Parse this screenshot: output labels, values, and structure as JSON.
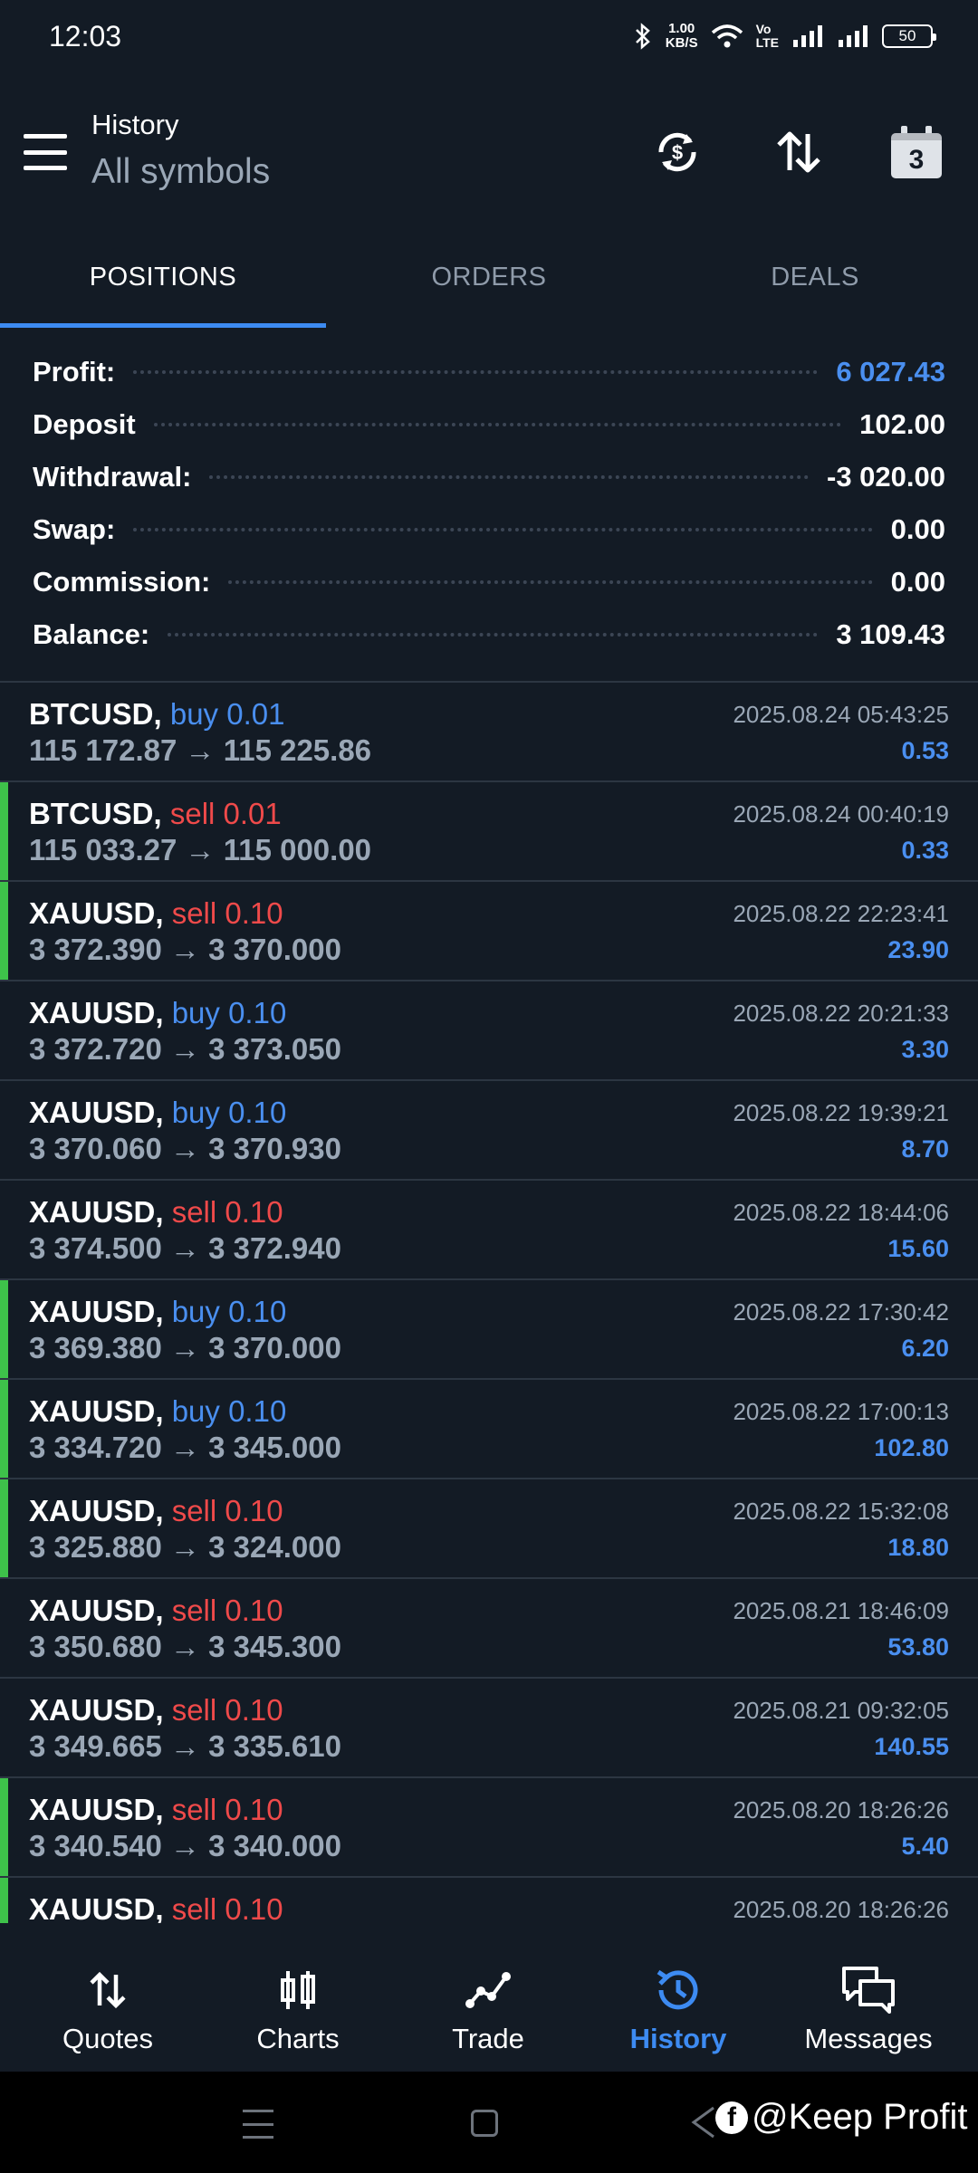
{
  "status_bar": {
    "time": "12:03",
    "speed_top": "1.00",
    "speed_bottom": "KB/S",
    "volte_top": "Vo",
    "volte_bottom": "LTE",
    "battery": "50"
  },
  "header": {
    "title": "History",
    "subtitle": "All symbols",
    "calendar_day": "3"
  },
  "tabs": [
    {
      "label": "POSITIONS",
      "active": true
    },
    {
      "label": "ORDERS",
      "active": false
    },
    {
      "label": "DEALS",
      "active": false
    }
  ],
  "summary": [
    {
      "label": "Profit:",
      "value": "6 027.43",
      "highlight": true
    },
    {
      "label": "Deposit",
      "value": "102.00",
      "highlight": false
    },
    {
      "label": "Withdrawal:",
      "value": "-3 020.00",
      "highlight": false
    },
    {
      "label": "Swap:",
      "value": "0.00",
      "highlight": false
    },
    {
      "label": "Commission:",
      "value": "0.00",
      "highlight": false
    },
    {
      "label": "Balance:",
      "value": "3 109.43",
      "highlight": false
    }
  ],
  "positions": [
    {
      "symbol": "BTCUSD,",
      "side": "buy 0.01",
      "type": "buy",
      "open": "115 172.87",
      "close": "115 225.86",
      "time": "2025.08.24 05:43:25",
      "profit": "0.53",
      "marked": false
    },
    {
      "symbol": "BTCUSD,",
      "side": "sell 0.01",
      "type": "sell",
      "open": "115 033.27",
      "close": "115 000.00",
      "time": "2025.08.24 00:40:19",
      "profit": "0.33",
      "marked": true
    },
    {
      "symbol": "XAUUSD,",
      "side": "sell 0.10",
      "type": "sell",
      "open": "3 372.390",
      "close": "3 370.000",
      "time": "2025.08.22 22:23:41",
      "profit": "23.90",
      "marked": true
    },
    {
      "symbol": "XAUUSD,",
      "side": "buy 0.10",
      "type": "buy",
      "open": "3 372.720",
      "close": "3 373.050",
      "time": "2025.08.22 20:21:33",
      "profit": "3.30",
      "marked": false
    },
    {
      "symbol": "XAUUSD,",
      "side": "buy 0.10",
      "type": "buy",
      "open": "3 370.060",
      "close": "3 370.930",
      "time": "2025.08.22 19:39:21",
      "profit": "8.70",
      "marked": false
    },
    {
      "symbol": "XAUUSD,",
      "side": "sell 0.10",
      "type": "sell",
      "open": "3 374.500",
      "close": "3 372.940",
      "time": "2025.08.22 18:44:06",
      "profit": "15.60",
      "marked": false
    },
    {
      "symbol": "XAUUSD,",
      "side": "buy 0.10",
      "type": "buy",
      "open": "3 369.380",
      "close": "3 370.000",
      "time": "2025.08.22 17:30:42",
      "profit": "6.20",
      "marked": true
    },
    {
      "symbol": "XAUUSD,",
      "side": "buy 0.10",
      "type": "buy",
      "open": "3 334.720",
      "close": "3 345.000",
      "time": "2025.08.22 17:00:13",
      "profit": "102.80",
      "marked": true
    },
    {
      "symbol": "XAUUSD,",
      "side": "sell 0.10",
      "type": "sell",
      "open": "3 325.880",
      "close": "3 324.000",
      "time": "2025.08.22 15:32:08",
      "profit": "18.80",
      "marked": true
    },
    {
      "symbol": "XAUUSD,",
      "side": "sell 0.10",
      "type": "sell",
      "open": "3 350.680",
      "close": "3 345.300",
      "time": "2025.08.21 18:46:09",
      "profit": "53.80",
      "marked": false
    },
    {
      "symbol": "XAUUSD,",
      "side": "sell 0.10",
      "type": "sell",
      "open": "3 349.665",
      "close": "3 335.610",
      "time": "2025.08.21 09:32:05",
      "profit": "140.55",
      "marked": false
    },
    {
      "symbol": "XAUUSD,",
      "side": "sell 0.10",
      "type": "sell",
      "open": "3 340.540",
      "close": "3 340.000",
      "time": "2025.08.20 18:26:26",
      "profit": "5.40",
      "marked": true
    },
    {
      "symbol": "XAUUSD,",
      "side": "sell 0.10",
      "type": "sell",
      "open": "",
      "close": "",
      "time": "2025.08.20 18:26:26",
      "profit": "",
      "marked": true
    }
  ],
  "nav": [
    {
      "label": "Quotes",
      "icon": "quotes-icon",
      "active": false
    },
    {
      "label": "Charts",
      "icon": "charts-icon",
      "active": false
    },
    {
      "label": "Trade",
      "icon": "trade-icon",
      "active": false
    },
    {
      "label": "History",
      "icon": "history-icon",
      "active": true
    },
    {
      "label": "Messages",
      "icon": "messages-icon",
      "active": false
    }
  ],
  "watermark": "@Keep Profit",
  "colors": {
    "background": "#131b25",
    "accent": "#3d8bf2",
    "buy": "#4a8ff0",
    "sell": "#ef4a4a",
    "marker": "#3ec24a"
  }
}
